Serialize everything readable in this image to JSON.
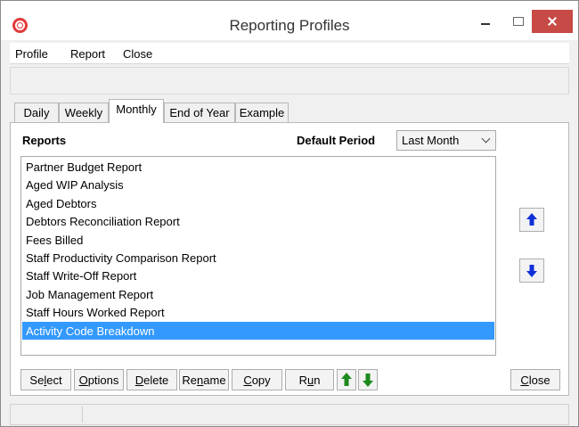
{
  "window": {
    "title": "Reporting Profiles"
  },
  "menu": {
    "items": [
      "Profile",
      "Report",
      "Close"
    ]
  },
  "tabs": [
    {
      "label": "Daily",
      "active": false
    },
    {
      "label": "Weekly",
      "active": false
    },
    {
      "label": "Monthly",
      "active": true
    },
    {
      "label": "End of Year",
      "active": false
    },
    {
      "label": "Example",
      "active": false
    }
  ],
  "panel": {
    "reports_label": "Reports",
    "period_label": "Default Period",
    "period_value": "Last Month"
  },
  "reports": [
    "Partner Budget Report",
    "Aged WIP Analysis",
    "Aged Debtors",
    "Debtors Reconciliation Report",
    "Fees Billed",
    "Staff Productivity Comparison Report",
    "Staff Write-Off Report",
    "Job Management Report",
    "Staff Hours Worked Report",
    "Activity Code Breakdown"
  ],
  "selected_report_index": 9,
  "buttons": {
    "select": {
      "pre": "Se",
      "ul": "l",
      "post": "ect"
    },
    "options": {
      "pre": "",
      "ul": "O",
      "post": "ptions"
    },
    "delete": {
      "pre": "",
      "ul": "D",
      "post": "elete"
    },
    "rename": {
      "pre": "Re",
      "ul": "n",
      "post": "ame"
    },
    "copy": {
      "pre": "",
      "ul": "C",
      "post": "opy"
    },
    "run": {
      "pre": "R",
      "ul": "u",
      "post": "n"
    },
    "close": {
      "pre": "",
      "ul": "C",
      "post": "lose"
    }
  },
  "colors": {
    "selection": "#3399ff",
    "arrow_blue": "#1030d8",
    "arrow_green": "#1e8a1e",
    "close_button": "#c74a46",
    "app_icon": "#e23a3a"
  }
}
